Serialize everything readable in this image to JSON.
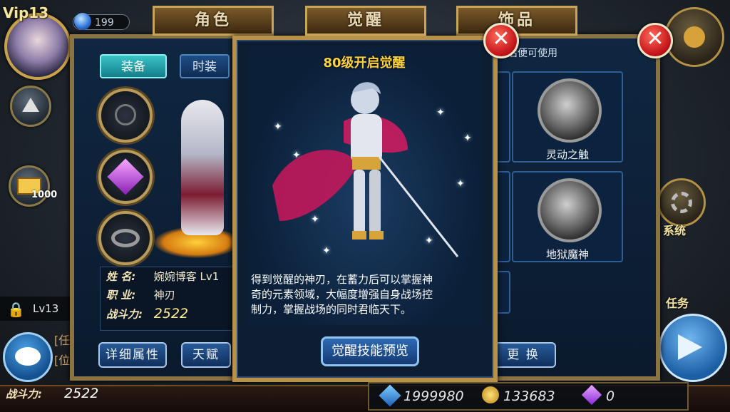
{
  "hud": {
    "vip_label": "Vip13",
    "gem_partial": "199",
    "mail_count": "1000",
    "level_strip": "Lv13",
    "system_label": "系统",
    "task_label": "任务",
    "chat_bracket": "[任",
    "chat_bracket2": "[位"
  },
  "bottom_bar": {
    "power_label": "战斗力:",
    "power_value": "2522",
    "diamonds": "1999980",
    "gold": "133683",
    "crystal": "0"
  },
  "character_panel": {
    "tab_title": "角色",
    "tab_equip": "装备",
    "tab_fashion": "时装",
    "info": {
      "name_key": "姓 名:",
      "name_value": "婉婉博客 Lv1",
      "class_key": "职 业:",
      "class_value": "神刃",
      "power_key": "战斗力:",
      "power_value": "2522"
    },
    "detail_button": "详细属性",
    "talent_button": "天赋"
  },
  "decoration_panel": {
    "tab_title": "饰品",
    "subtitle": "后便可使用",
    "slots": [
      {
        "name": "灵动之触"
      },
      {
        "name": "地狱魔神"
      }
    ],
    "replace_button": "更 换"
  },
  "awaken_panel": {
    "tab_title": "觉醒",
    "heading": "80级开启觉醒",
    "desc_line1": "得到觉醒的神刃，在蓄力后可以掌握神",
    "desc_line2": "奇的元素领域，大幅度增强自身战场控",
    "desc_line3": "制力，掌握战场的同时君临天下。",
    "preview_button": "觉醒技能预览"
  },
  "colors": {
    "panel_bg": "#0d1e33",
    "gold_trim": "#c8a55a",
    "title_yellow": "#ffd23c",
    "close_red": "#c4151b"
  }
}
